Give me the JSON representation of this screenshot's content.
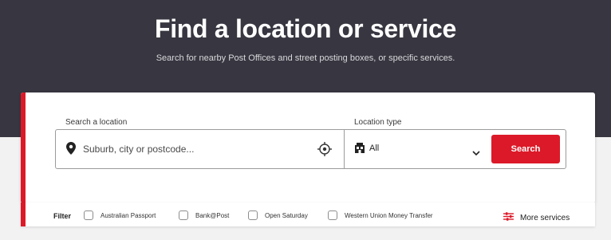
{
  "hero": {
    "title": "Find a location or service",
    "subtitle": "Search for nearby Post Offices and street posting boxes, or specific services."
  },
  "search": {
    "location_label": "Search a location",
    "location_placeholder": "Suburb, city or postcode...",
    "location_value": "",
    "type_label": "Location type",
    "type_value": "All",
    "button_label": "Search"
  },
  "filters": {
    "label": "Filter",
    "options": [
      {
        "label": "Australian Passport",
        "checked": false
      },
      {
        "label": "Bank@Post",
        "checked": false
      },
      {
        "label": "Open Saturday",
        "checked": false
      },
      {
        "label": "Western Union Money Transfer",
        "checked": false
      }
    ],
    "more_label": "More services"
  },
  "colors": {
    "accent": "#dc1928",
    "hero_bg": "#383640",
    "page_bg": "#f3f2f2"
  },
  "icons": {
    "location": "map-pin-icon",
    "locate": "crosshair-icon",
    "type": "post-office-icon",
    "dropdown": "chevron-down-icon",
    "more": "sliders-icon"
  }
}
